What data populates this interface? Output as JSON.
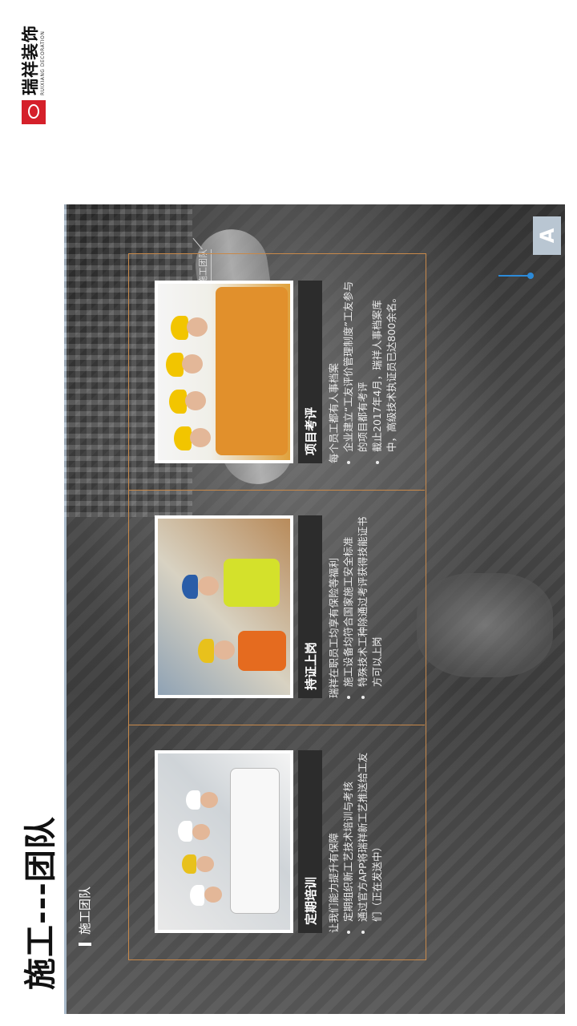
{
  "logo": {
    "brand_cn": "瑞祥装饰",
    "brand_en": "RUIXIANG DECORATION"
  },
  "page_title": "施工---团队",
  "section_label": "施工团队",
  "ghost_label": "施工团队",
  "corner_letter": "A",
  "cards": [
    {
      "title": "定期培训",
      "intro": "让我们能力提升有保障",
      "bullets": [
        "定期组织新工艺技术培训与考核",
        "通过官方APP将瑞祥新工艺推送给工友们（正在发送中）"
      ]
    },
    {
      "title": "持证上岗",
      "intro": "瑞祥在职员工均享有保险等福利",
      "bullets": [
        "施工设备均符合国家施工安全标准",
        "特殊技术工种除通过考评获得技能证书方可以上岗"
      ]
    },
    {
      "title": "项目考评",
      "intro": "每个员工都有人事档案",
      "bullets": [
        "企业建立“工友评价管理制度”工友参与的项目都有考评",
        "截止2017年4月，瑞祥人事档案库中，高级技术执证员已达800余名。"
      ]
    }
  ],
  "colors": {
    "frame": "#c8894a",
    "brand_red": "#d5202a",
    "accent_blue": "#2c8ad8"
  }
}
